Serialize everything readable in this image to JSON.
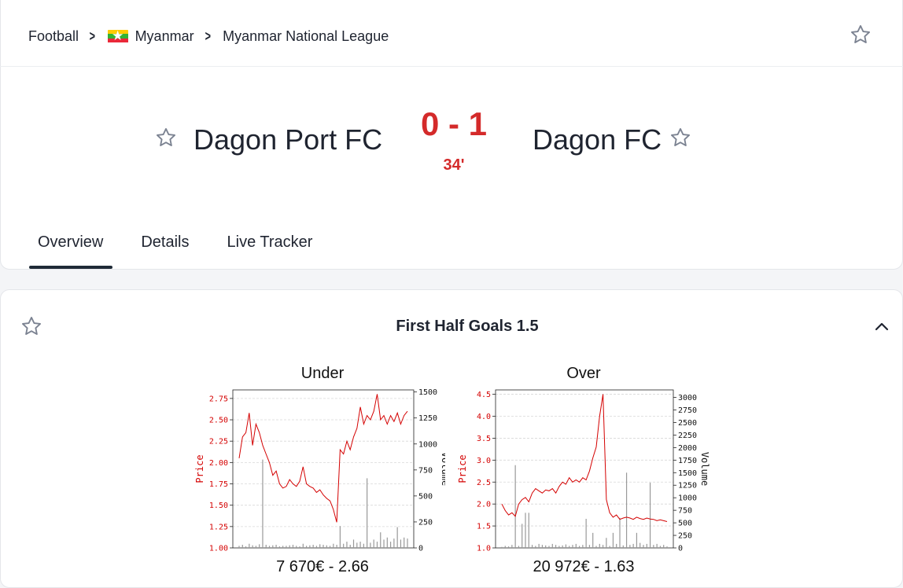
{
  "breadcrumb": {
    "sport": "Football",
    "country": "Myanmar",
    "league": "Myanmar National League",
    "flag_colors": [
      "#FECB00",
      "#34B233",
      "#EA2839"
    ]
  },
  "icons": {
    "favorite": "star-outline-icon",
    "separator": "chevron-right-icon",
    "collapse": "chevron-up-icon"
  },
  "match": {
    "home_team": "Dagon Port FC",
    "away_team": "Dagon FC",
    "score": "0 - 1",
    "minute": "34'"
  },
  "colors": {
    "accent": "#d42a2a",
    "price_line": "#d40000",
    "volume_bar": "#999999"
  },
  "tabs": [
    {
      "label": "Overview",
      "active": true
    },
    {
      "label": "Details",
      "active": false
    },
    {
      "label": "Live Tracker",
      "active": false
    }
  ],
  "market": {
    "title": "First Half Goals 1.5",
    "runners": [
      {
        "name": "Under",
        "footer": "7 670€ - 2.66"
      },
      {
        "name": "Over",
        "footer": "20 972€ - 1.63"
      }
    ]
  },
  "chart_data": [
    {
      "type": "line",
      "title": "Under",
      "ylabel": "Price",
      "y2label": "Volume",
      "ylim": [
        1.0,
        2.85
      ],
      "yticks": [
        "1.00",
        "1.25",
        "1.50",
        "1.75",
        "2.00",
        "2.25",
        "2.50",
        "2.75"
      ],
      "y2lim": [
        0,
        1520
      ],
      "y2ticks": [
        "0",
        "250",
        "500",
        "750",
        "1000",
        "1250",
        "1500"
      ],
      "grid": true,
      "series": [
        {
          "axis": "price",
          "values": [
            2.05,
            2.3,
            2.35,
            2.58,
            2.2,
            2.45,
            2.35,
            2.2,
            2.1,
            2.0,
            1.85,
            1.9,
            1.75,
            1.7,
            1.72,
            1.8,
            1.75,
            1.72,
            1.78,
            1.95,
            1.75,
            1.72,
            1.7,
            1.65,
            1.68,
            1.62,
            1.58,
            1.55,
            1.45,
            1.3,
            2.15,
            2.1,
            2.25,
            2.15,
            2.3,
            2.4,
            2.65,
            2.45,
            2.55,
            2.5,
            2.6,
            2.8,
            2.5,
            2.55,
            2.45,
            2.55,
            2.48,
            2.58,
            2.45,
            2.55,
            2.6
          ]
        },
        {
          "axis": "volume",
          "values": [
            20,
            30,
            15,
            40,
            25,
            20,
            35,
            850,
            30,
            20,
            25,
            30,
            15,
            20,
            20,
            25,
            30,
            20,
            15,
            40,
            20,
            25,
            30,
            20,
            35,
            30,
            25,
            20,
            40,
            30,
            210,
            40,
            60,
            30,
            80,
            50,
            60,
            40,
            670,
            50,
            80,
            60,
            150,
            80,
            100,
            60,
            90,
            200,
            80,
            100,
            90
          ]
        }
      ]
    },
    {
      "type": "line",
      "title": "Over",
      "ylabel": "Price",
      "y2label": "Volume",
      "ylim": [
        1.0,
        4.6
      ],
      "yticks": [
        "1.0",
        "1.5",
        "2.0",
        "2.5",
        "3.0",
        "3.5",
        "4.0",
        "4.5"
      ],
      "y2lim": [
        0,
        3150
      ],
      "y2ticks": [
        "0",
        "250",
        "500",
        "750",
        "1000",
        "1250",
        "1500",
        "1750",
        "2000",
        "2250",
        "2500",
        "2750",
        "3000"
      ],
      "grid": true,
      "series": [
        {
          "axis": "price",
          "values": [
            2.0,
            1.85,
            1.75,
            1.8,
            1.72,
            2.0,
            2.1,
            2.15,
            2.05,
            2.25,
            2.35,
            2.3,
            2.25,
            2.32,
            2.3,
            2.35,
            2.25,
            2.4,
            2.5,
            2.45,
            2.6,
            2.5,
            2.55,
            2.5,
            2.6,
            2.55,
            2.75,
            3.05,
            3.3,
            4.0,
            4.5,
            2.1,
            1.8,
            1.7,
            1.75,
            1.65,
            1.68,
            1.7,
            1.68,
            1.65,
            1.7,
            1.67,
            1.65,
            1.68,
            1.66,
            1.65,
            1.62,
            1.64,
            1.62,
            1.6
          ]
        },
        {
          "axis": "volume",
          "values": [
            20,
            40,
            30,
            60,
            1650,
            40,
            480,
            700,
            700,
            60,
            40,
            80,
            60,
            50,
            40,
            80,
            60,
            40,
            50,
            70,
            40,
            60,
            80,
            40,
            60,
            580,
            60,
            300,
            40,
            80,
            60,
            200,
            40,
            300,
            80,
            600,
            50,
            1500,
            60,
            80,
            300,
            100,
            60,
            80,
            1300,
            60,
            80,
            40,
            60,
            30
          ]
        }
      ]
    }
  ]
}
